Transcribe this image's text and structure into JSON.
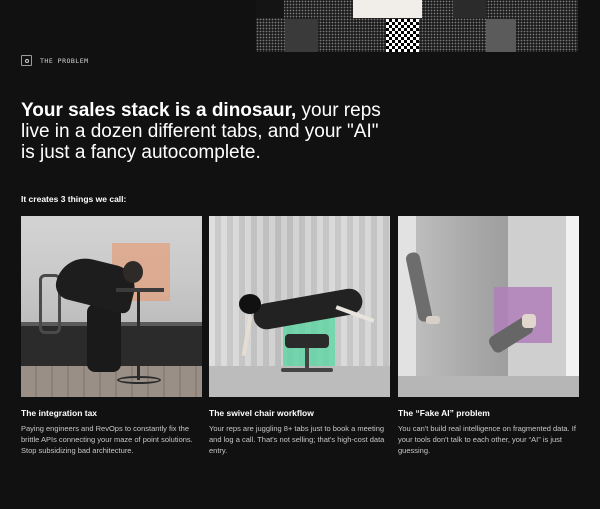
{
  "eyebrow": {
    "icon": "target-icon",
    "label": "THE PROBLEM"
  },
  "headline": {
    "bold": "Your sales stack is a dinosaur,",
    "rest": " your reps live in a dozen different tabs, and your \"AI\" is just a fancy autocomplete."
  },
  "subhead": "It creates 3 things we call:",
  "cards": [
    {
      "title": "The integration tax",
      "description": "Paying engineers and RevOps to constantly fix the brittle APIs connecting your maze of point solutions. Stop subsidizing bad architecture.",
      "accent": "#E2A07E"
    },
    {
      "title": "The swivel chair workflow",
      "description": "Your reps are juggling 8+ tabs just to book a meeting and log a call. That's not selling; that's high-cost data entry.",
      "accent": "#5CD6A4"
    },
    {
      "title": "The “Fake AI” problem",
      "description": "You can't build real intelligence on fragmented data. If your tools don't talk to each other, your “AI” is just guessing.",
      "accent": "#B07EBA"
    }
  ],
  "colors": {
    "background": "#111111",
    "text": "#FFFFFF",
    "muted_text": "#C7C7C7"
  }
}
